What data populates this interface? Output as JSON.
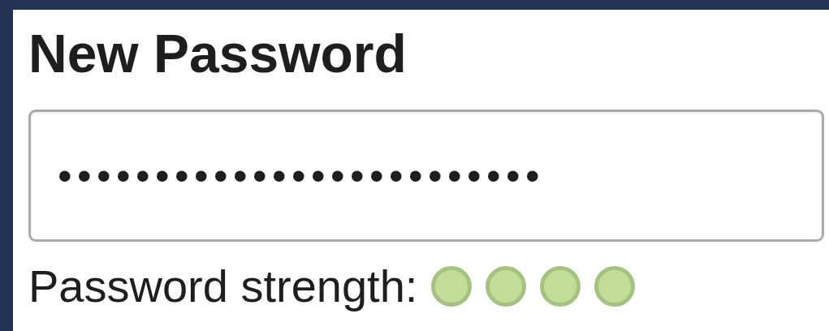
{
  "heading": "New Password",
  "password_field": {
    "value": "•••••••••••••••••••••••••"
  },
  "strength": {
    "label": "Password strength:",
    "meters": [
      {
        "on": true
      },
      {
        "on": true
      },
      {
        "on": true
      },
      {
        "on": true
      }
    ]
  }
}
